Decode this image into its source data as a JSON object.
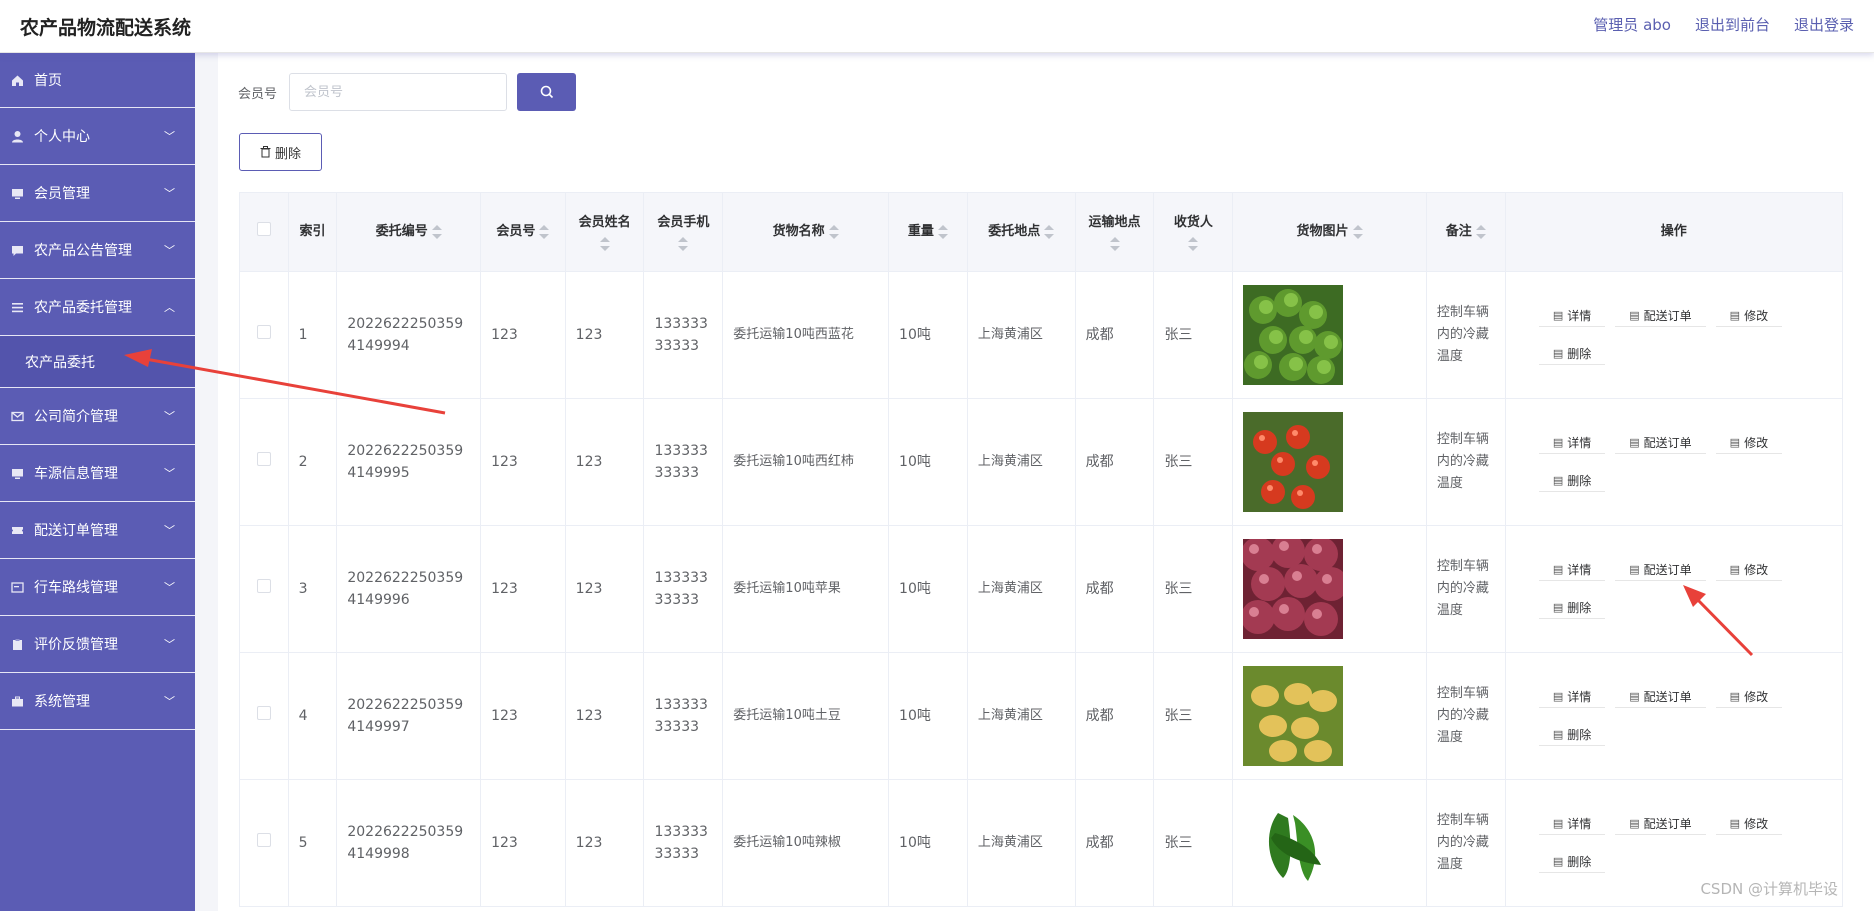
{
  "app": {
    "title": "农产品物流配送系统"
  },
  "header": {
    "admin": "管理员 abo",
    "front": "退出到前台",
    "logout": "退出登录"
  },
  "sidebar": {
    "items": [
      {
        "label": "首页",
        "icon": "home-icon",
        "arrow": ""
      },
      {
        "label": "个人中心",
        "icon": "user-icon",
        "arrow": "﹀"
      },
      {
        "label": "会员管理",
        "icon": "monitor-icon",
        "arrow": "﹀"
      },
      {
        "label": "农产品公告管理",
        "icon": "message-icon",
        "arrow": "﹀"
      },
      {
        "label": "农产品委托管理",
        "icon": "list-icon",
        "arrow": "︿"
      },
      {
        "label": "公司简介管理",
        "icon": "mail-icon",
        "arrow": "﹀"
      },
      {
        "label": "车源信息管理",
        "icon": "monitor-icon",
        "arrow": "﹀"
      },
      {
        "label": "配送订单管理",
        "icon": "ticket-icon",
        "arrow": "﹀"
      },
      {
        "label": "行车路线管理",
        "icon": "card-icon",
        "arrow": "﹀"
      },
      {
        "label": "评价反馈管理",
        "icon": "clipboard-icon",
        "arrow": "﹀"
      },
      {
        "label": "系统管理",
        "icon": "briefcase-icon",
        "arrow": "﹀"
      }
    ],
    "subitem": "农产品委托"
  },
  "search": {
    "label": "会员号",
    "placeholder": "会员号"
  },
  "toolbar": {
    "delete_label": "删除"
  },
  "table": {
    "headers": {
      "index": "索引",
      "entrust_no": "委托编号",
      "member_no": "会员号",
      "member_name": "会员姓名",
      "member_phone": "会员手机",
      "goods_name": "货物名称",
      "weight": "重量",
      "entrust_place": "委托地点",
      "transport_place": "运输地点",
      "receiver": "收货人",
      "goods_image": "货物图片",
      "remark": "备注",
      "ops": "操作"
    },
    "actions": {
      "detail": "详情",
      "order": "配送订单",
      "edit": "修改",
      "delete": "删除"
    },
    "rows": [
      {
        "index": "1",
        "entrust_no": "20226222503594149994",
        "member_no": "123",
        "member_name": "123",
        "phone": "13333333333",
        "goods": "委托运输10吨西蓝花",
        "weight": "10吨",
        "place": "上海黄浦区",
        "dest": "成都",
        "receiver": "张三",
        "image": "broccoli",
        "remark": "控制车辆内的冷藏温度"
      },
      {
        "index": "2",
        "entrust_no": "20226222503594149995",
        "member_no": "123",
        "member_name": "123",
        "phone": "13333333333",
        "goods": "委托运输10吨西红柿",
        "weight": "10吨",
        "place": "上海黄浦区",
        "dest": "成都",
        "receiver": "张三",
        "image": "tomato",
        "remark": "控制车辆内的冷藏温度"
      },
      {
        "index": "3",
        "entrust_no": "20226222503594149996",
        "member_no": "123",
        "member_name": "123",
        "phone": "13333333333",
        "goods": "委托运输10吨苹果",
        "weight": "10吨",
        "place": "上海黄浦区",
        "dest": "成都",
        "receiver": "张三",
        "image": "apple",
        "remark": "控制车辆内的冷藏温度"
      },
      {
        "index": "4",
        "entrust_no": "20226222503594149997",
        "member_no": "123",
        "member_name": "123",
        "phone": "13333333333",
        "goods": "委托运输10吨土豆",
        "weight": "10吨",
        "place": "上海黄浦区",
        "dest": "成都",
        "receiver": "张三",
        "image": "potato",
        "remark": "控制车辆内的冷藏温度"
      },
      {
        "index": "5",
        "entrust_no": "20226222503594149998",
        "member_no": "123",
        "member_name": "123",
        "phone": "13333333333",
        "goods": "委托运输10吨辣椒",
        "weight": "10吨",
        "place": "上海黄浦区",
        "dest": "成都",
        "receiver": "张三",
        "image": "pepper",
        "remark": "控制车辆内的冷藏温度"
      }
    ]
  },
  "watermark": "CSDN @计算机毕设"
}
